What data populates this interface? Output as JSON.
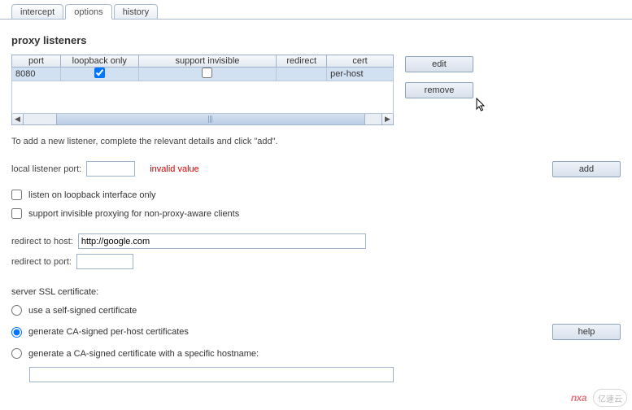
{
  "tabs": {
    "intercept": "intercept",
    "options": "options",
    "history": "history"
  },
  "section_title": "proxy listeners",
  "table": {
    "headers": {
      "port": "port",
      "loopback": "loopback only",
      "invisible": "support invisible",
      "redirect": "redirect",
      "cert": "cert"
    },
    "row": {
      "port": "8080",
      "loopback_checked": true,
      "invisible_checked": false,
      "redirect": "",
      "cert": "per-host"
    }
  },
  "buttons": {
    "edit": "edit",
    "remove": "remove",
    "add": "add",
    "help": "help"
  },
  "help_text": "To add a new listener, complete the relevant details and click \"add\".",
  "form": {
    "port_label": "local listener port:",
    "port_value": "",
    "port_error": "invalid value",
    "loopback_label": "listen on loopback interface only",
    "invisible_label": "support invisible proxying for non-proxy-aware clients",
    "redirect_host_label": "redirect to host:",
    "redirect_host_value": "http://google.com",
    "redirect_port_label": "redirect to port:",
    "redirect_port_value": ""
  },
  "ssl": {
    "heading": "server SSL certificate:",
    "self_signed": "use a self-signed certificate",
    "ca_perhost": "generate CA-signed per-host certificates",
    "ca_hostname": "generate a CA-signed certificate with a specific hostname:",
    "hostname_value": ""
  },
  "watermark": {
    "left": "nxa",
    "right": "亿速云"
  }
}
